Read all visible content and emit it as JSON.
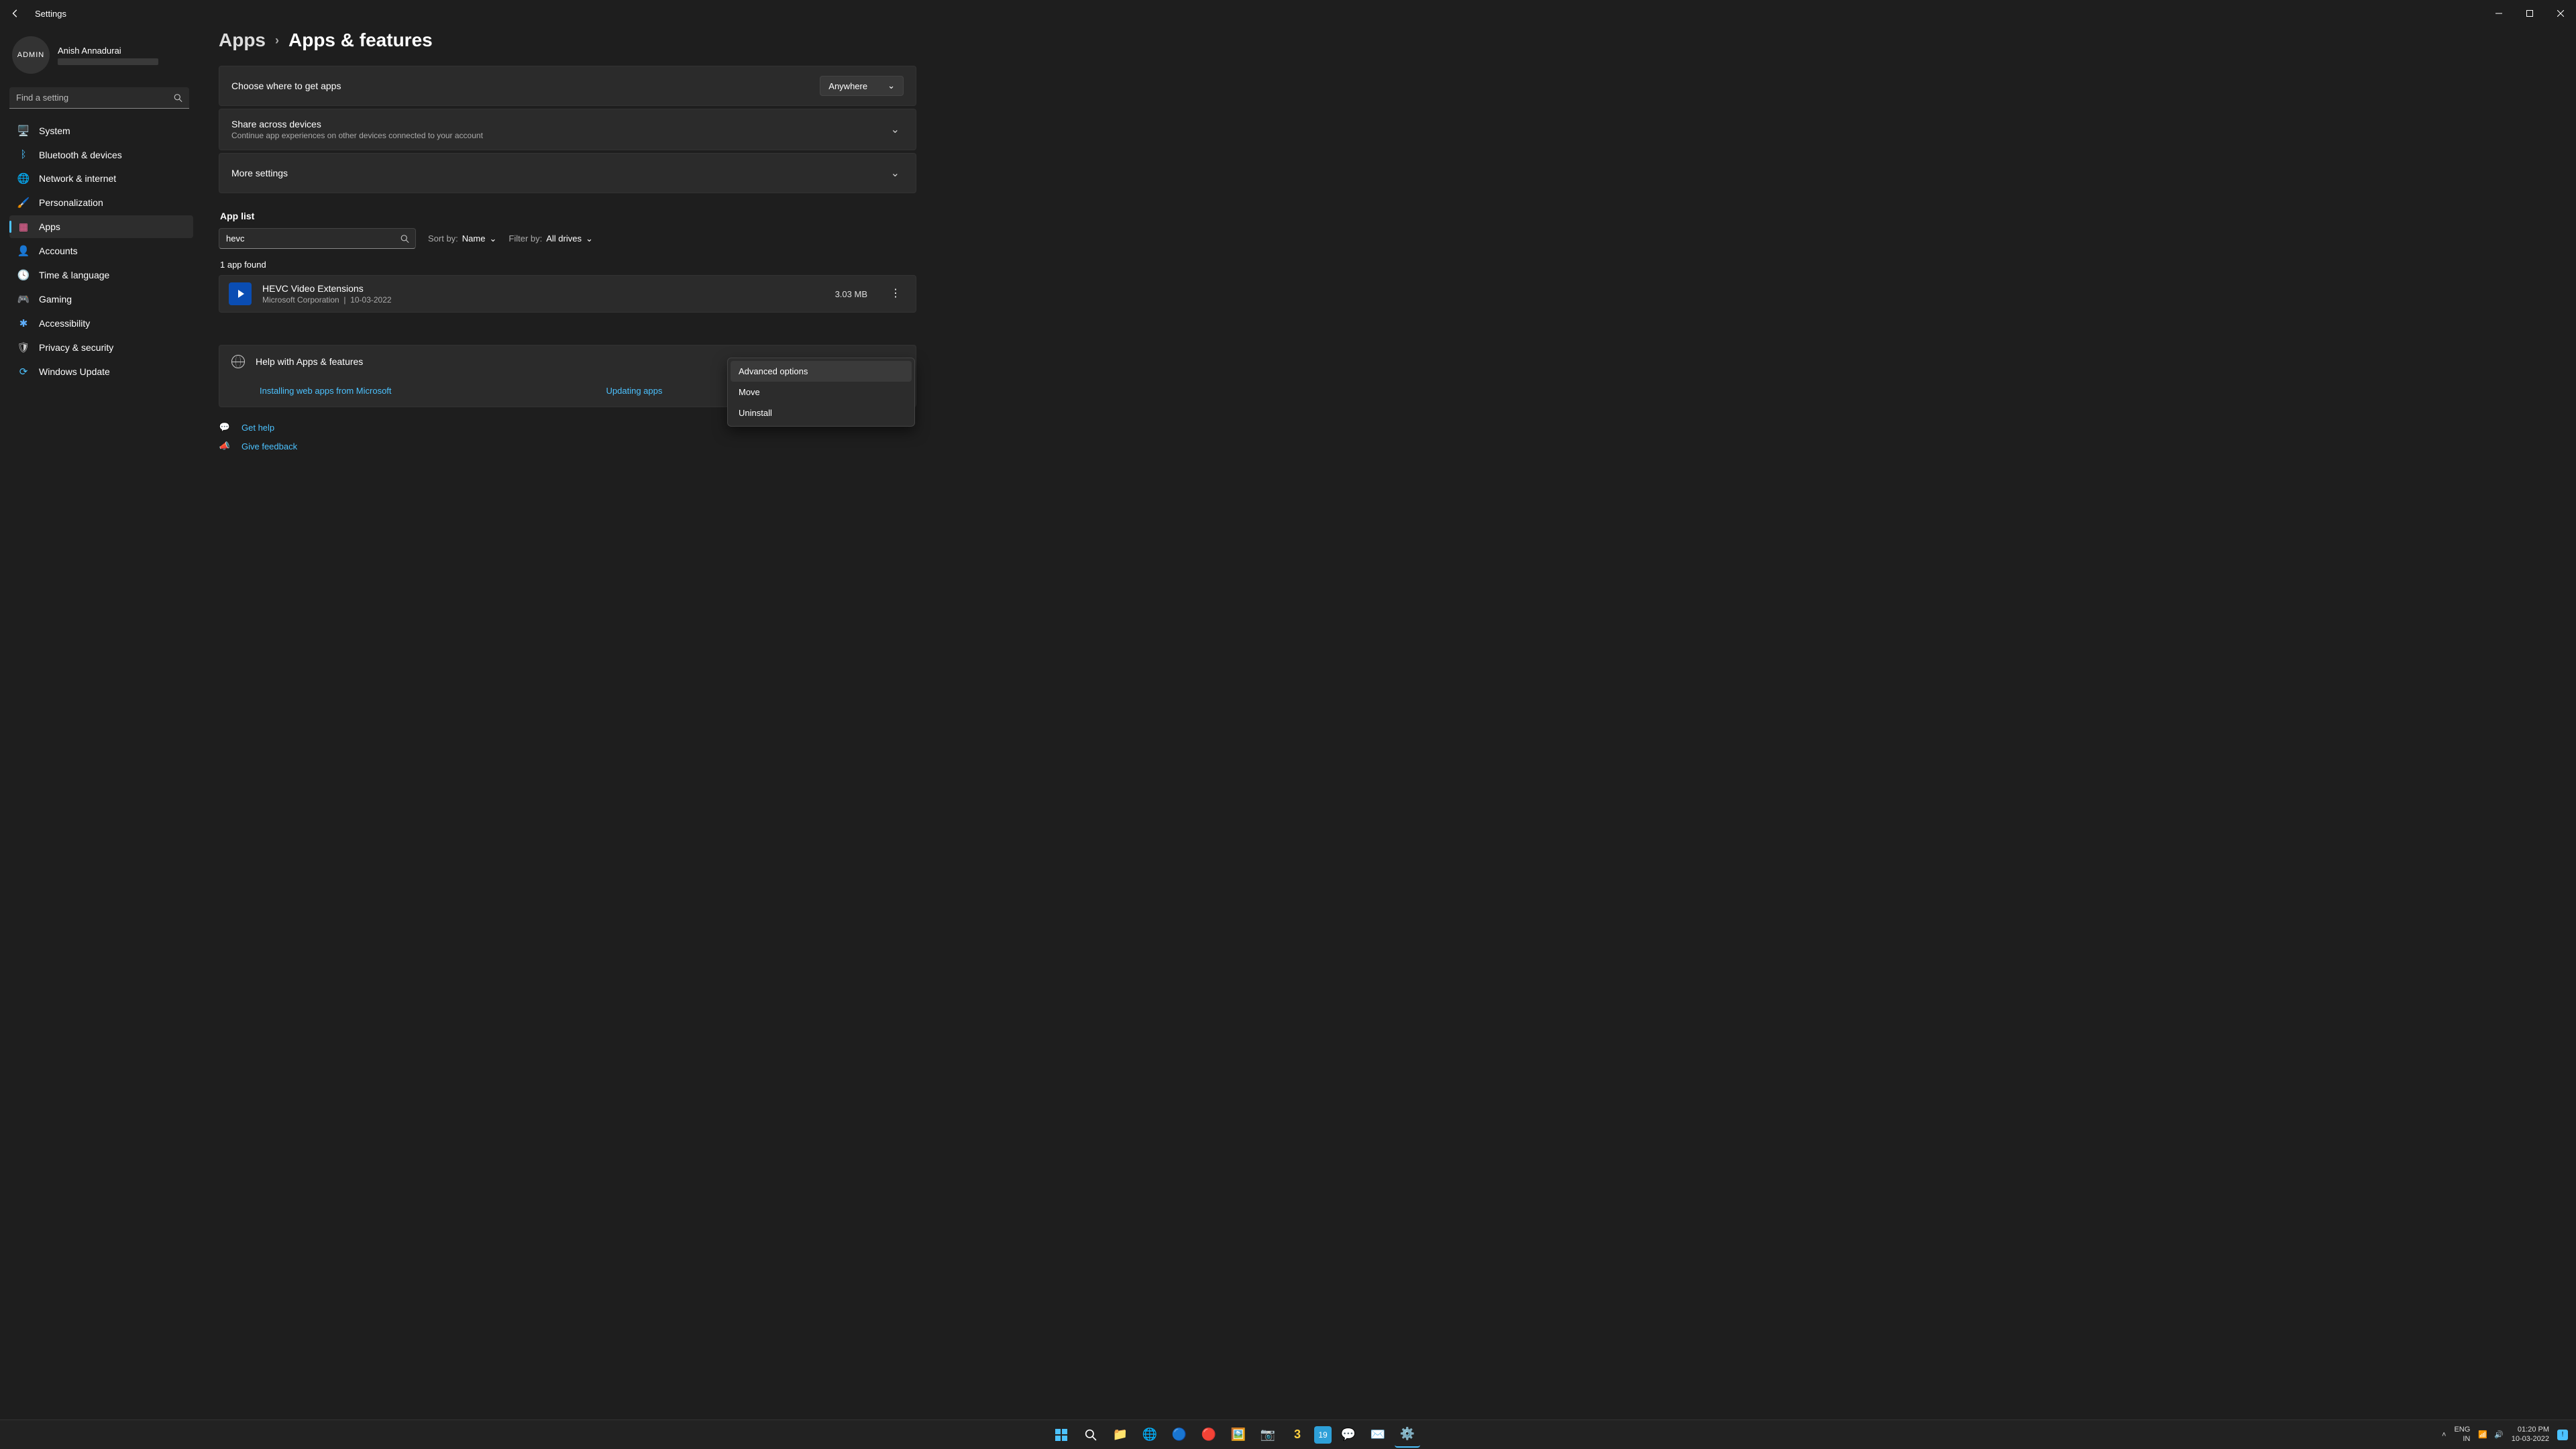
{
  "titlebar": {
    "title": "Settings"
  },
  "user": {
    "name": "Anish Annadurai",
    "avatar_label": "ADMIN"
  },
  "search": {
    "placeholder": "Find a setting"
  },
  "nav": [
    {
      "icon": "🖥️",
      "label": "System",
      "color": "#4cc2ff"
    },
    {
      "icon": "ᛒ",
      "label": "Bluetooth & devices",
      "color": "#4cc2ff"
    },
    {
      "icon": "🌐",
      "label": "Network & internet",
      "color": "#4cc2ff"
    },
    {
      "icon": "🖌️",
      "label": "Personalization",
      "color": "#e0a030"
    },
    {
      "icon": "▦",
      "label": "Apps",
      "color": "#ff6aa0",
      "active": true
    },
    {
      "icon": "👤",
      "label": "Accounts",
      "color": "#6ad0ff"
    },
    {
      "icon": "🕓",
      "label": "Time & language",
      "color": "#6ad0ff"
    },
    {
      "icon": "🎮",
      "label": "Gaming",
      "color": "#bbb"
    },
    {
      "icon": "✱",
      "label": "Accessibility",
      "color": "#60b0ff"
    },
    {
      "icon": "🛡",
      "label": "Privacy & security",
      "color": "#ccc"
    },
    {
      "icon": "⟳",
      "label": "Windows Update",
      "color": "#4cc2ff"
    }
  ],
  "breadcrumb": {
    "parent": "Apps",
    "current": "Apps & features"
  },
  "cards": {
    "choose": {
      "title": "Choose where to get apps",
      "value": "Anywhere"
    },
    "share": {
      "title": "Share across devices",
      "sub": "Continue app experiences on other devices connected to your account"
    },
    "more": {
      "title": "More settings"
    }
  },
  "applist": {
    "section": "App list",
    "search_value": "hevc",
    "sort_label": "Sort by:",
    "sort_value": "Name",
    "filter_label": "Filter by:",
    "filter_value": "All drives",
    "found_text": "1 app found"
  },
  "app": {
    "name": "HEVC Video Extensions",
    "publisher": "Microsoft Corporation",
    "sep": "|",
    "date": "10-03-2022",
    "size": "3.03 MB"
  },
  "context": {
    "advanced": "Advanced options",
    "move": "Move",
    "uninstall": "Uninstall"
  },
  "help": {
    "title": "Help with Apps & features",
    "link1": "Installing web apps from Microsoft",
    "link2": "Updating apps"
  },
  "footer": {
    "help": "Get help",
    "feedback": "Give feedback"
  },
  "taskbar": {
    "lang1": "ENG",
    "lang2": "IN",
    "time": "01:20 PM",
    "date": "10-03-2022"
  }
}
